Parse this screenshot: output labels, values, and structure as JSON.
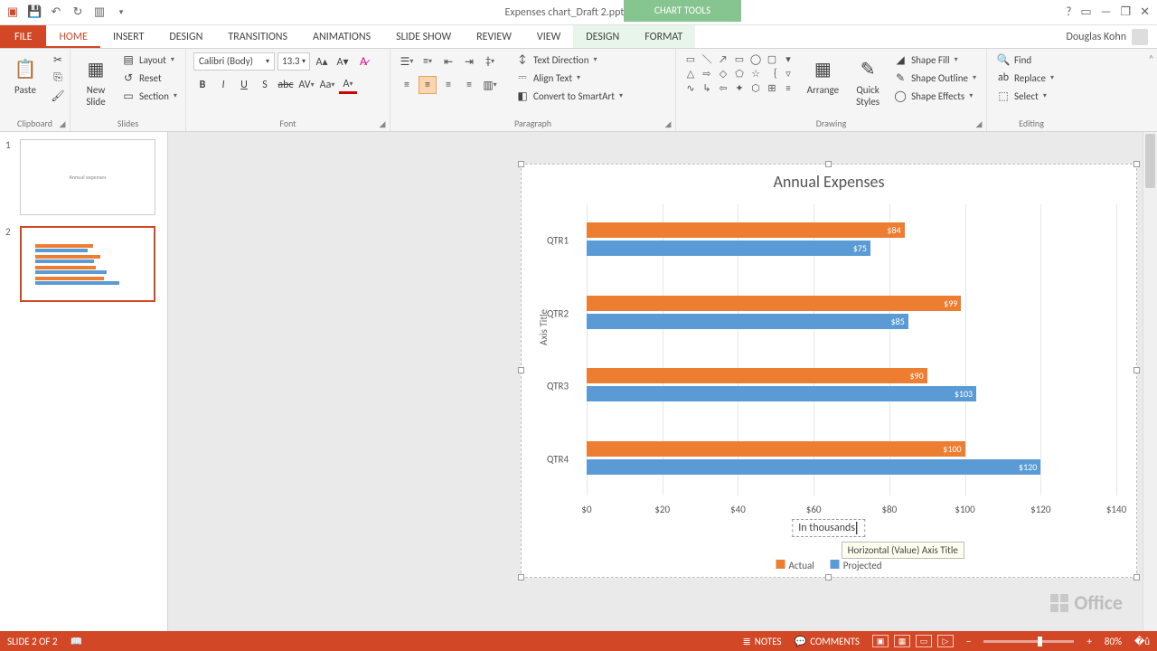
{
  "app": {
    "title": "Expenses chart_Draft 2.pptx - PowerPoint",
    "context_group": "CHART TOOLS"
  },
  "window_controls": {
    "help": "?",
    "ribbon_opts": "▭",
    "min": "—",
    "restore": "❐",
    "close": "✕"
  },
  "user": {
    "name": "Douglas Kohn"
  },
  "tabs": {
    "file": "FILE",
    "home": "HOME",
    "insert": "INSERT",
    "design": "DESIGN",
    "transitions": "TRANSITIONS",
    "animations": "ANIMATIONS",
    "slideshow": "SLIDE SHOW",
    "review": "REVIEW",
    "view": "VIEW",
    "ct_design": "DESIGN",
    "ct_format": "FORMAT"
  },
  "ribbon": {
    "clipboard": {
      "paste": "Paste",
      "cut": "Cut",
      "copy": "Copy",
      "painter": "Format Painter",
      "label": "Clipboard"
    },
    "slides": {
      "new_slide": "New\nSlide",
      "layout": "Layout",
      "reset": "Reset",
      "section": "Section",
      "label": "Slides"
    },
    "font": {
      "name": "Calibri (Body)",
      "size": "13.3",
      "label": "Font",
      "bold": "B",
      "italic": "I",
      "underline": "U",
      "shadow": "S",
      "strike": "abc",
      "spacing": "AV",
      "case": "Aa",
      "color": "A"
    },
    "paragraph": {
      "text_direction": "Text Direction",
      "align_text": "Align Text",
      "smartart": "Convert to SmartArt",
      "label": "Paragraph"
    },
    "drawing": {
      "arrange": "Arrange",
      "quick_styles": "Quick\nStyles",
      "fill": "Shape Fill",
      "outline": "Shape Outline",
      "effects": "Shape Effects",
      "label": "Drawing"
    },
    "editing": {
      "find": "Find",
      "replace": "Replace",
      "select": "Select",
      "label": "Editing"
    }
  },
  "thumbs": {
    "s1_title": "Annual expenses",
    "s2_alt": "chart thumbnail"
  },
  "chart_data": {
    "type": "bar",
    "title": "Annual Expenses",
    "y_axis_title": "Axis Title",
    "x_axis_title_editing": "In thousands",
    "tooltip": "Horizontal (Value) Axis Title",
    "categories": [
      "QTR1",
      "QTR2",
      "QTR3",
      "QTR4"
    ],
    "series": [
      {
        "name": "Actual",
        "color": "#ed7d31",
        "values": [
          84,
          99,
          90,
          100
        ]
      },
      {
        "name": "Projected",
        "color": "#5b9bd5",
        "values": [
          75,
          85,
          103,
          120
        ]
      }
    ],
    "x_ticks": [
      0,
      20,
      40,
      60,
      80,
      100,
      120,
      140
    ],
    "x_prefix": "$",
    "xlabel": "",
    "ylabel": "Axis Title",
    "xlim": [
      0,
      140
    ]
  },
  "status": {
    "slide": "SLIDE 2 OF 2",
    "notes": "NOTES",
    "comments": "COMMENTS",
    "zoom": "80%"
  },
  "branding": {
    "office": "Office"
  }
}
